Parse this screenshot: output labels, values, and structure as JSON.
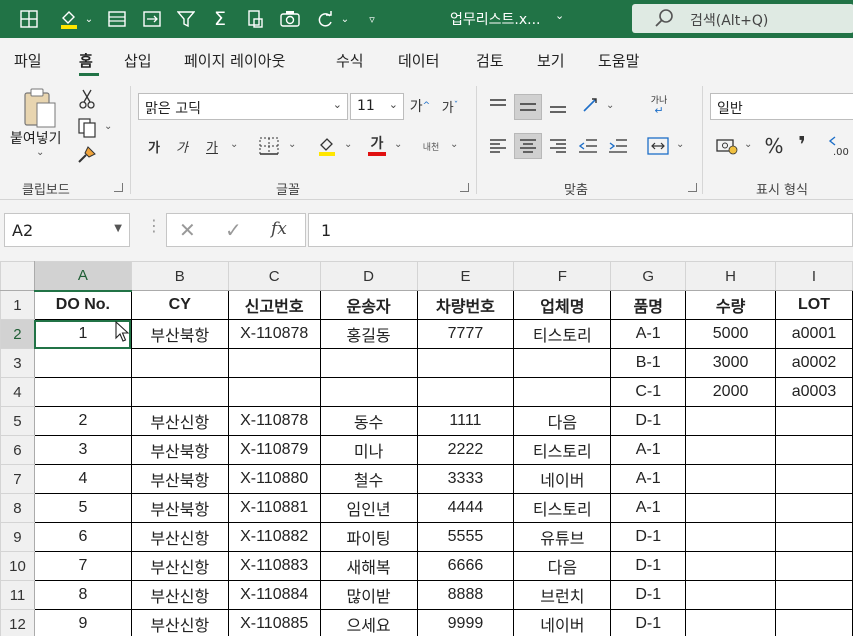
{
  "window": {
    "document_title": "업무리스트.x...",
    "search_placeholder": "검색(Alt+Q)"
  },
  "tabs": [
    {
      "label": "파일",
      "active": false
    },
    {
      "label": "홈",
      "active": true
    },
    {
      "label": "삽입",
      "active": false
    },
    {
      "label": "페이지 레이아웃",
      "active": false
    },
    {
      "label": "수식",
      "active": false
    },
    {
      "label": "데이터",
      "active": false
    },
    {
      "label": "검토",
      "active": false
    },
    {
      "label": "보기",
      "active": false
    },
    {
      "label": "도움말",
      "active": false
    }
  ],
  "ribbon": {
    "clipboard": {
      "paste_label": "붙여넣기",
      "group_label": "클립보드"
    },
    "font": {
      "font_name": "맑은 고딕",
      "font_size": "11",
      "group_label": "글꼴",
      "bold": "가",
      "italic": "가",
      "underline": "가",
      "font_color_glyph": "가",
      "phonetic": "내천"
    },
    "alignment": {
      "group_label": "맞춤",
      "wrap_glyph": "가나"
    },
    "number": {
      "format": "일반",
      "group_label": "표시 형식",
      "percent": "%",
      "comma": "❜"
    }
  },
  "formula_bar": {
    "name_box": "A2",
    "fx_label": "fx",
    "value": "1"
  },
  "colors": {
    "accent": "#217346"
  },
  "sheet": {
    "columns": [
      "A",
      "B",
      "C",
      "D",
      "E",
      "F",
      "G",
      "H",
      "I"
    ],
    "row_numbers": [
      "1",
      "2",
      "3",
      "4",
      "5",
      "6",
      "7",
      "8",
      "9",
      "10",
      "11",
      "12"
    ],
    "header": [
      "DO No.",
      "CY",
      "신고번호",
      "운송자",
      "차량번호",
      "업체명",
      "품명",
      "수량",
      "LOT"
    ],
    "rows": [
      [
        "1",
        "부산북항",
        "X-110878",
        "홍길동",
        "7777",
        "티스토리",
        "A-1",
        "5000",
        "a0001"
      ],
      [
        "",
        "",
        "",
        "",
        "",
        "",
        "B-1",
        "3000",
        "a0002"
      ],
      [
        "",
        "",
        "",
        "",
        "",
        "",
        "C-1",
        "2000",
        "a0003"
      ],
      [
        "2",
        "부산신항",
        "X-110878",
        "동수",
        "1111",
        "다음",
        "D-1",
        "",
        ""
      ],
      [
        "3",
        "부산북항",
        "X-110879",
        "미나",
        "2222",
        "티스토리",
        "A-1",
        "",
        ""
      ],
      [
        "4",
        "부산북항",
        "X-110880",
        "철수",
        "3333",
        "네이버",
        "A-1",
        "",
        ""
      ],
      [
        "5",
        "부산북항",
        "X-110881",
        "임인년",
        "4444",
        "티스토리",
        "A-1",
        "",
        ""
      ],
      [
        "6",
        "부산신항",
        "X-110882",
        "파이팅",
        "5555",
        "유튜브",
        "D-1",
        "",
        ""
      ],
      [
        "7",
        "부산신항",
        "X-110883",
        "새해복",
        "6666",
        "다음",
        "D-1",
        "",
        ""
      ],
      [
        "8",
        "부산신항",
        "X-110884",
        "많이받",
        "8888",
        "브런치",
        "D-1",
        "",
        ""
      ],
      [
        "9",
        "부산신항",
        "X-110885",
        "으세요",
        "9999",
        "네이버",
        "D-1",
        "",
        ""
      ]
    ]
  }
}
